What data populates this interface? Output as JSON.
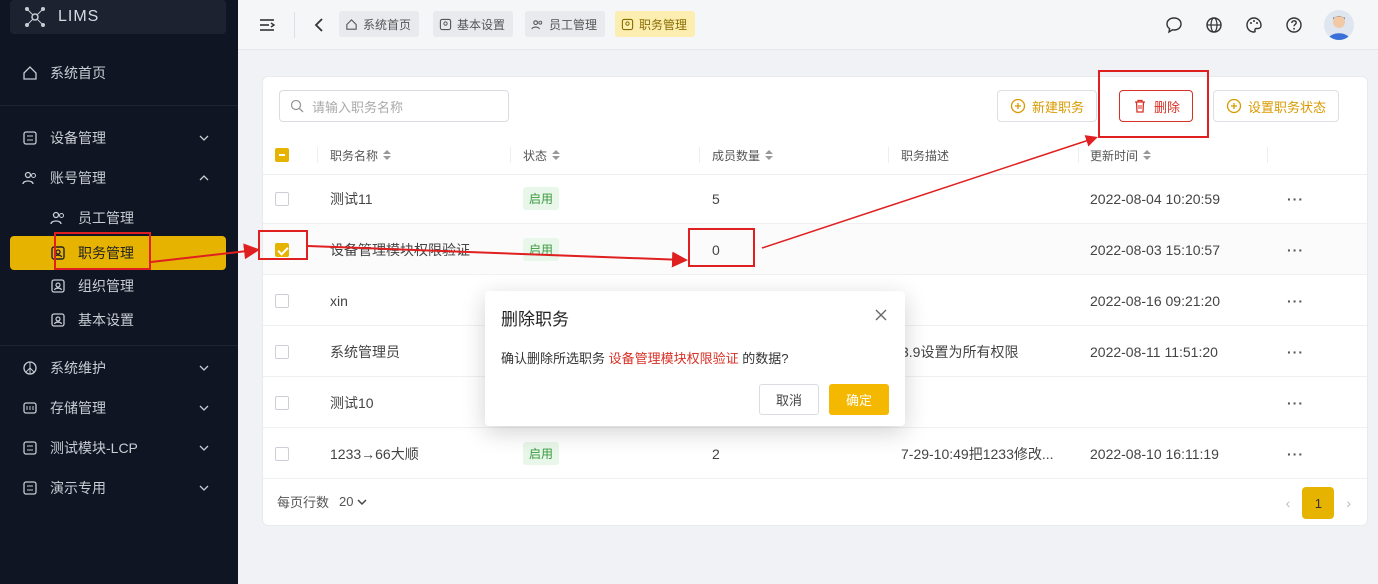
{
  "app": {
    "name": "LIMS"
  },
  "sidebar": {
    "items": [
      {
        "label": "系统首页",
        "icon": "home-icon"
      },
      {
        "label": "设备管理",
        "icon": "device-icon"
      },
      {
        "label": "账号管理",
        "icon": "users-icon"
      },
      {
        "label": "员工管理",
        "icon": "users-icon"
      },
      {
        "label": "职务管理",
        "icon": "badge-icon",
        "active": true
      },
      {
        "label": "组织管理",
        "icon": "badge-icon"
      },
      {
        "label": "基本设置",
        "icon": "badge-icon"
      },
      {
        "label": "系统维护",
        "icon": "peace-icon"
      },
      {
        "label": "存储管理",
        "icon": "storage-icon"
      },
      {
        "label": "测试模块-LCP",
        "icon": "grid-icon"
      },
      {
        "label": "演示专用",
        "icon": "grid-icon"
      }
    ]
  },
  "topbar": {
    "tabs": [
      {
        "label": "系统首页"
      },
      {
        "label": "基本设置"
      },
      {
        "label": "员工管理"
      },
      {
        "label": "职务管理",
        "active": true
      }
    ]
  },
  "toolbar": {
    "search_placeholder": "请输入职务名称",
    "new_label": "新建职务",
    "delete_label": "删除",
    "status_label": "设置职务状态"
  },
  "table": {
    "columns": [
      "职务名称",
      "状态",
      "成员数量",
      "职务描述",
      "更新时间"
    ],
    "rows": [
      {
        "name": "测试11",
        "status": "启用",
        "count": "5",
        "desc": "",
        "time": "2022-08-04 10:20:59",
        "checked": false
      },
      {
        "name": "设备管理模块权限验证",
        "status": "启用",
        "count": "0",
        "desc": "",
        "time": "2022-08-03 15:10:57",
        "checked": true
      },
      {
        "name": "xin",
        "status": "",
        "count": "",
        "desc": "",
        "time": "2022-08-16 09:21:20",
        "checked": false
      },
      {
        "name": "系统管理员",
        "status": "",
        "count": "",
        "desc": "3.9设置为所有权限",
        "time": "2022-08-11 11:51:20",
        "checked": false
      },
      {
        "name": "测试10",
        "status": "",
        "count": "",
        "desc": "",
        "time": "",
        "checked": false
      },
      {
        "name": "1233→66大顺",
        "status": "启用",
        "count": "2",
        "desc": "7-29-10:49把1233修改...",
        "time": "2022-08-10 16:11:19",
        "checked": false
      }
    ],
    "row_menu": "···"
  },
  "footer": {
    "page_size_label": "每页行数",
    "page_size": "20",
    "current_page": "1"
  },
  "dialog": {
    "title": "删除职务",
    "msg_prefix": "确认删除所选职务",
    "msg_highlight": "设备管理模块权限验证",
    "msg_suffix": "的数据?",
    "cancel": "取消",
    "ok": "确定"
  },
  "colors": {
    "accent": "#e6b400",
    "danger": "#d93025",
    "sidebar_bg": "#0f1523",
    "annotation": "#e02020"
  }
}
